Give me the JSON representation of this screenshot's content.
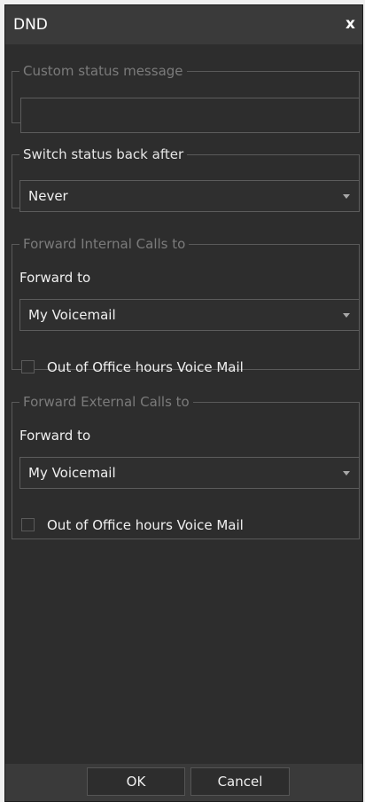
{
  "dialog": {
    "title": "DND",
    "close_label": "x",
    "custom_status": {
      "legend": "Custom status message",
      "value": ""
    },
    "switch_status": {
      "legend": "Switch status back after",
      "selected": "Never"
    },
    "forward_internal": {
      "legend": "Forward Internal Calls to",
      "forward_to_label": "Forward to",
      "selected": "My Voicemail",
      "checkbox_label": "Out of Office hours Voice Mail",
      "checkbox_checked": false
    },
    "forward_external": {
      "legend": "Forward External Calls to",
      "forward_to_label": "Forward to",
      "selected": "My Voicemail",
      "checkbox_label": "Out of Office hours Voice Mail",
      "checkbox_checked": false
    },
    "buttons": {
      "ok": "OK",
      "cancel": "Cancel"
    }
  },
  "colors": {
    "background": "#2d2d2d",
    "titlebar": "#3a3a3a",
    "border": "#5a5a5a",
    "text": "#f0f0f0",
    "muted_text": "#7b7b7b"
  }
}
